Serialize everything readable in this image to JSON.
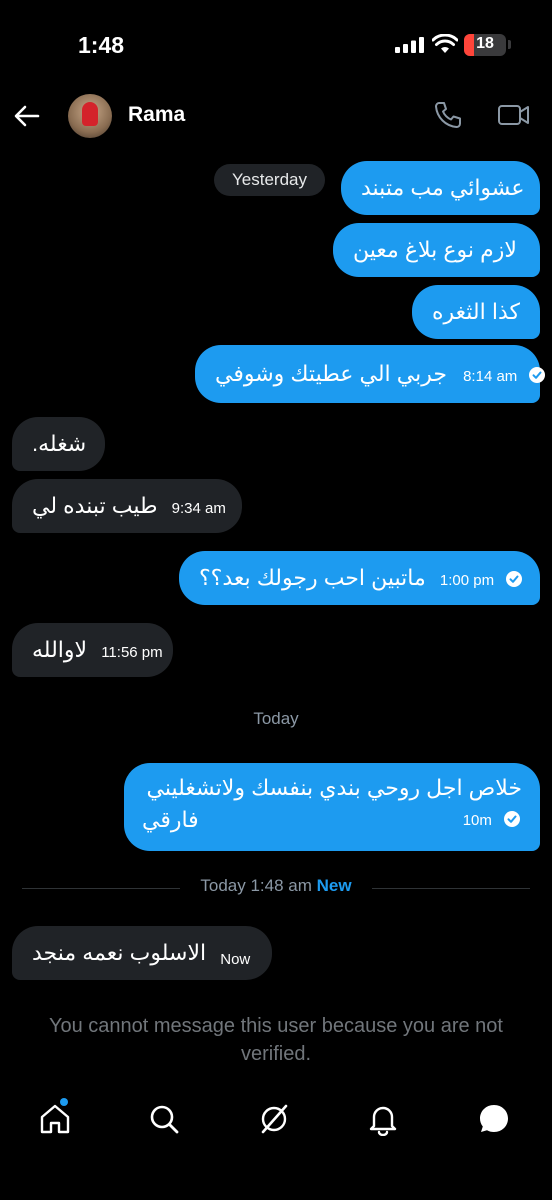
{
  "status_bar": {
    "time": "1:48",
    "battery": "18"
  },
  "header": {
    "name": "Rama"
  },
  "date_label": "Yesterday",
  "messages": [
    {
      "dir": "out",
      "text": "عشوائي مب متبند"
    },
    {
      "dir": "out",
      "text": "لازم نوع بلاغ معين"
    },
    {
      "dir": "out",
      "text": "كذا الثغره"
    },
    {
      "dir": "out",
      "text": "جربي الي عطيتك وشوفي",
      "time": "8:14 am"
    },
    {
      "dir": "in",
      "text": "شغله."
    },
    {
      "dir": "in",
      "text": "طيب تبنده لي",
      "time": "9:34 am"
    },
    {
      "dir": "out",
      "text": "ماتبين احب رجولك بعد؟؟",
      "time": "1:00 pm"
    },
    {
      "dir": "in",
      "text": "لاوالله",
      "time": "11:56 pm"
    },
    {
      "dir": "out",
      "text_line1": "خلاص اجل روحي بندي بنفسك ولاتشغليني",
      "text_line2": "فارقي",
      "time": "10m"
    },
    {
      "dir": "in",
      "text": "الاسلوب نعمه منجد",
      "time": "Now"
    }
  ],
  "today_label": "Today",
  "divider": {
    "label": "Today 1:48 am",
    "new_label": "New"
  },
  "notice": "You cannot message this user because you are not verified.",
  "nav": [
    "home-icon",
    "search-icon",
    "grok-icon",
    "notifications-icon",
    "messages-icon"
  ],
  "colors": {
    "accent": "#1d9bf0",
    "incoming_bubble": "#202327",
    "background": "#000000"
  }
}
